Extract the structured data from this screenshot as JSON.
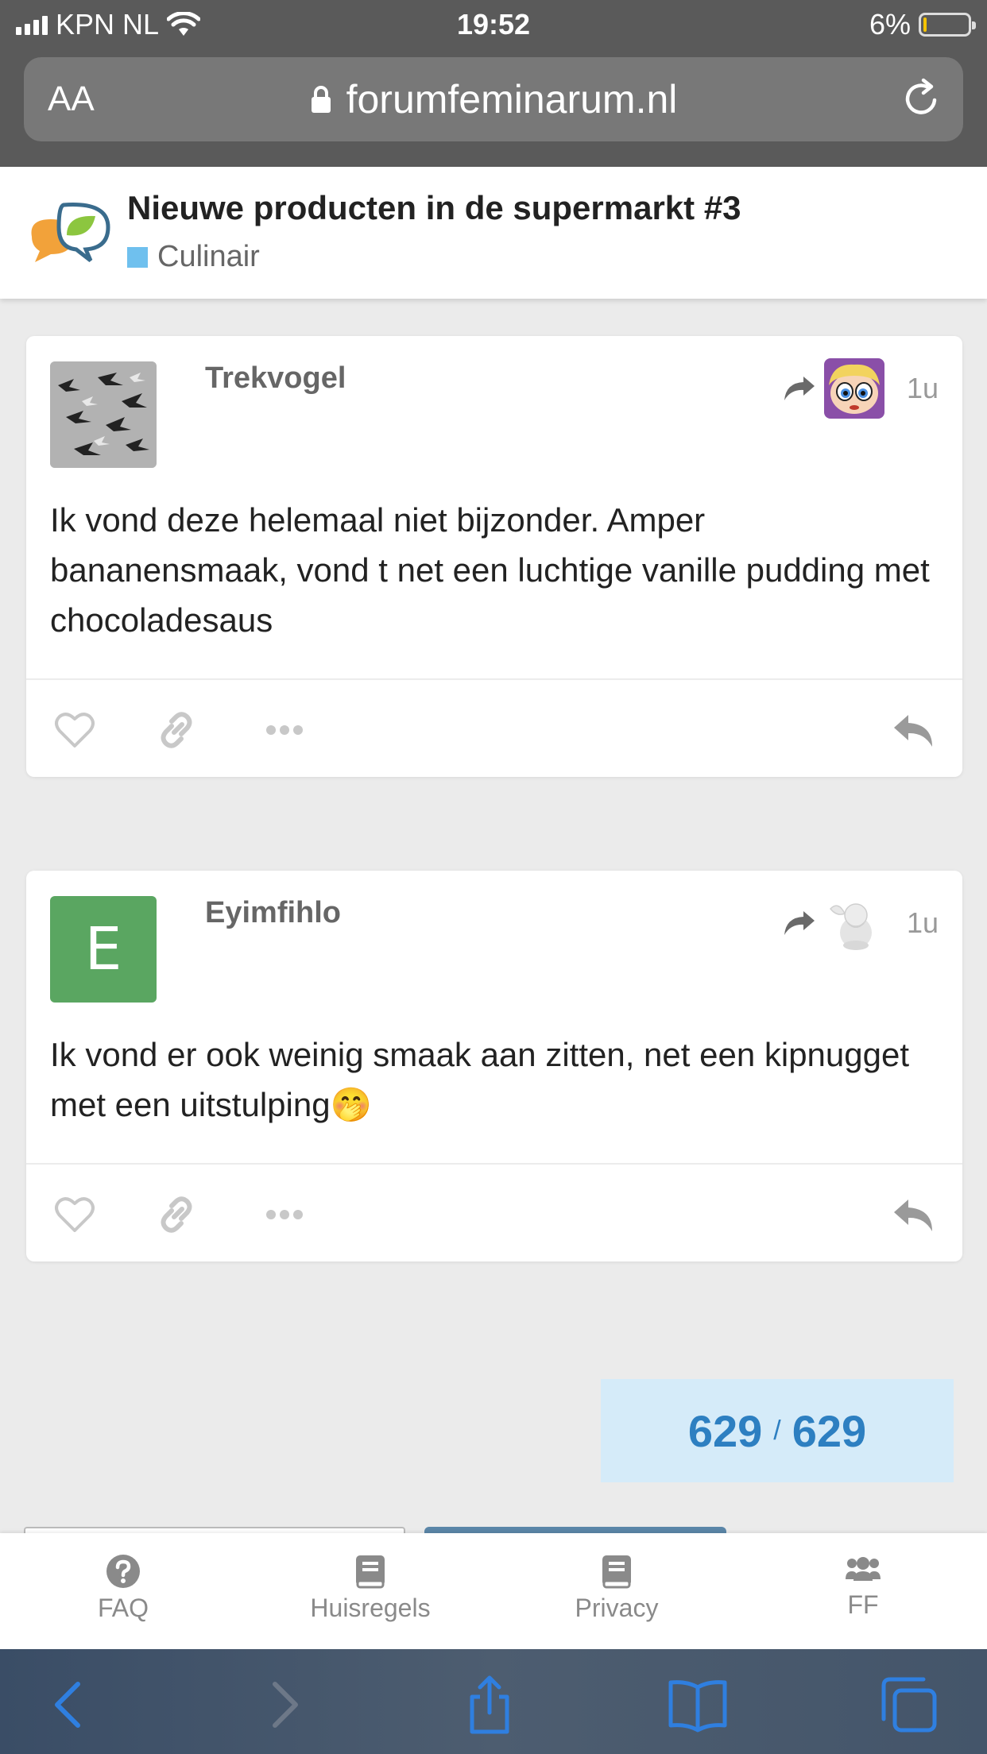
{
  "status_bar": {
    "carrier": "KPN NL",
    "time": "19:52",
    "battery_percent": "6%",
    "battery_level": 0.06
  },
  "browser": {
    "text_size_label": "AA",
    "url": "forumfeminarum.nl"
  },
  "topic": {
    "title": "Nieuwe producten in de supermarkt #3",
    "category": "Culinair",
    "category_color": "#6fc0ee"
  },
  "posts": [
    {
      "username": "Trekvogel",
      "date": "1u",
      "body": "Ik vond deze helemaal niet bijzonder. Amper bananensmaak, vond t net een luchtige vanille pudding met chocoladesaus"
    },
    {
      "username": "Eyimfihlo",
      "avatar_letter": "E",
      "avatar_color": "#5aa661",
      "date": "1u",
      "body": "Ik vond er ook weinig smaak aan zitten, net een kipnugget met een uitstulping🤭"
    }
  ],
  "progress": {
    "current": "629",
    "separator": "/",
    "total": "629"
  },
  "footer_nav": [
    {
      "label": "FAQ",
      "icon": "question-circle-icon"
    },
    {
      "label": "Huisregels",
      "icon": "book-icon"
    },
    {
      "label": "Privacy",
      "icon": "book-icon"
    },
    {
      "label": "FF",
      "icon": "users-icon"
    }
  ],
  "colors": {
    "accent": "#2d7fc1",
    "safari_blue": "#2f7fe0"
  }
}
